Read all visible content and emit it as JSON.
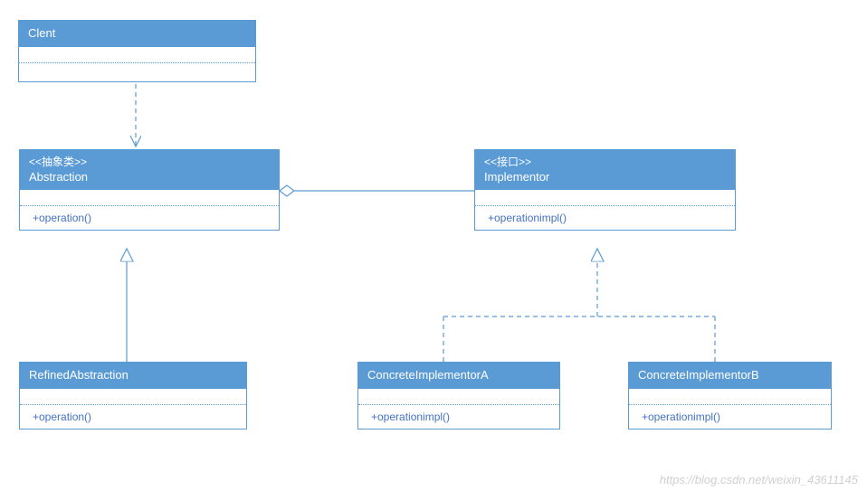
{
  "boxes": {
    "clent": {
      "title": "Clent",
      "stereotype": "",
      "method": ""
    },
    "abstraction": {
      "title": "Abstraction",
      "stereotype": "<<抽象类>>",
      "method": "+operation()"
    },
    "implementor": {
      "title": "Implementor",
      "stereotype": "<<接口>>",
      "method": "+operationimpl()"
    },
    "refined": {
      "title": "RefinedAbstraction",
      "stereotype": "",
      "method": "+operation()"
    },
    "concreteA": {
      "title": "ConcreteImplementorA",
      "stereotype": "",
      "method": "+operationimpl()"
    },
    "concreteB": {
      "title": "ConcreteImplementorB",
      "stereotype": "",
      "method": "+operationimpl()"
    }
  },
  "watermark": "https://blog.csdn.net/weixin_43611145",
  "chart_data": {
    "type": "uml_class_diagram",
    "pattern": "Bridge",
    "classes": [
      {
        "name": "Clent",
        "stereotype": null,
        "operations": []
      },
      {
        "name": "Abstraction",
        "stereotype": "抽象类",
        "operations": [
          "+operation()"
        ]
      },
      {
        "name": "Implementor",
        "stereotype": "接口",
        "operations": [
          "+operationimpl()"
        ]
      },
      {
        "name": "RefinedAbstraction",
        "stereotype": null,
        "operations": [
          "+operation()"
        ]
      },
      {
        "name": "ConcreteImplementorA",
        "stereotype": null,
        "operations": [
          "+operationimpl()"
        ]
      },
      {
        "name": "ConcreteImplementorB",
        "stereotype": null,
        "operations": [
          "+operationimpl()"
        ]
      }
    ],
    "relationships": [
      {
        "from": "Clent",
        "to": "Abstraction",
        "type": "dependency"
      },
      {
        "from": "Abstraction",
        "to": "Implementor",
        "type": "aggregation"
      },
      {
        "from": "RefinedAbstraction",
        "to": "Abstraction",
        "type": "generalization"
      },
      {
        "from": "ConcreteImplementorA",
        "to": "Implementor",
        "type": "realization"
      },
      {
        "from": "ConcreteImplementorB",
        "to": "Implementor",
        "type": "realization"
      }
    ]
  }
}
